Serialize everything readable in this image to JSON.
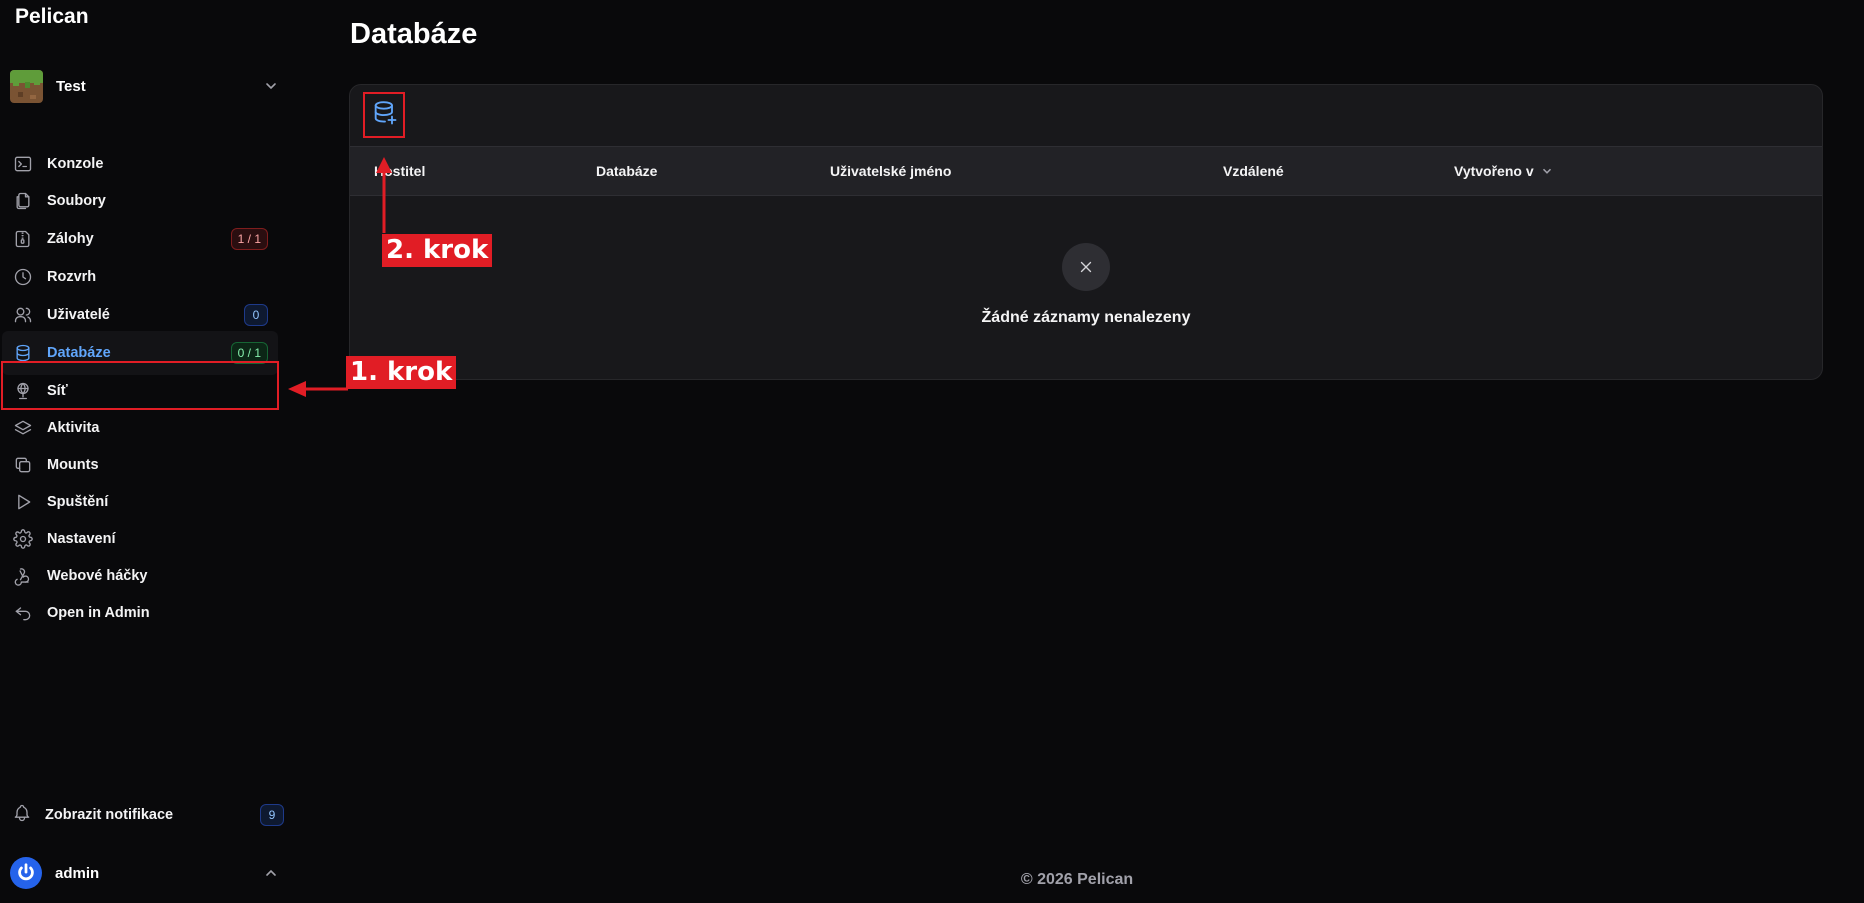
{
  "brand": "Pelican",
  "server": {
    "name": "Test"
  },
  "nav": [
    {
      "label": "Konzole",
      "icon": "terminal-icon"
    },
    {
      "label": "Soubory",
      "icon": "files-icon"
    },
    {
      "label": "Zálohy",
      "icon": "file-zip-icon",
      "badge": "1 / 1",
      "badge_color": "red"
    },
    {
      "label": "Rozvrh",
      "icon": "clock-icon"
    },
    {
      "label": "Uživatelé",
      "icon": "users-icon",
      "badge": "0",
      "badge_color": "blue"
    },
    {
      "label": "Databáze",
      "icon": "database-icon",
      "badge": "0 / 1",
      "badge_color": "green",
      "active": true
    },
    {
      "label": "Síť",
      "icon": "network-icon"
    },
    {
      "label": "Aktivita",
      "icon": "stack-icon"
    },
    {
      "label": "Mounts",
      "icon": "copy-icon"
    },
    {
      "label": "Spuštění",
      "icon": "play-icon"
    },
    {
      "label": "Nastavení",
      "icon": "settings-icon"
    },
    {
      "label": "Webové háčky",
      "icon": "webhook-icon"
    },
    {
      "label": "Open in Admin",
      "icon": "return-icon"
    }
  ],
  "notifications": {
    "label": "Zobrazit notifikace",
    "count": "9"
  },
  "user": {
    "name": "admin"
  },
  "page": {
    "title": "Databáze"
  },
  "table": {
    "columns": [
      "Hostitel",
      "Databáze",
      "Uživatelské jméno",
      "Vzdálené",
      "Vytvořeno v"
    ],
    "empty_text": "Žádné záznamy nenalezeny"
  },
  "footer": "© 2026 Pelican",
  "annotations": {
    "step1": "1. krok",
    "step2": "2. krok",
    "color": "#e11d25"
  },
  "colors": {
    "accent": "#60a5fa",
    "background": "#09090b",
    "card": "#18181b"
  }
}
